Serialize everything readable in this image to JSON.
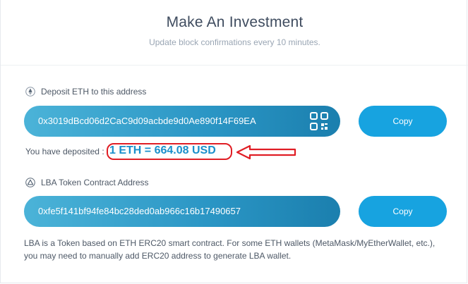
{
  "header": {
    "title": "Make An Investment",
    "subtitle": "Update block confirmations every 10 minutes."
  },
  "deposit": {
    "label": "Deposit ETH to this address",
    "icon": "ethereum-icon",
    "address": "0x3019dBcd06d2CaC9d09acbde9d0Ae890f14F69EA",
    "copy_label": "Copy",
    "deposited_label": "You have deposited :",
    "deposited_value": "1 ETH = 664.08 USD"
  },
  "contract": {
    "label": "LBA Token Contract Address",
    "icon": "token-icon",
    "address": "0xfe5f141bf94fe84bc28ded0ab966c16b17490657",
    "copy_label": "Copy"
  },
  "note": "LBA is a Token based on ETH ERC20 smart contract. For some ETH wallets (MetaMask/MyEtherWallet, etc.), you may need to manually add ERC20 address to generate LBA wallet.",
  "colors": {
    "accent": "#17a3e0",
    "annotation_red": "#e01e25",
    "value_blue": "#1a8fcb"
  }
}
